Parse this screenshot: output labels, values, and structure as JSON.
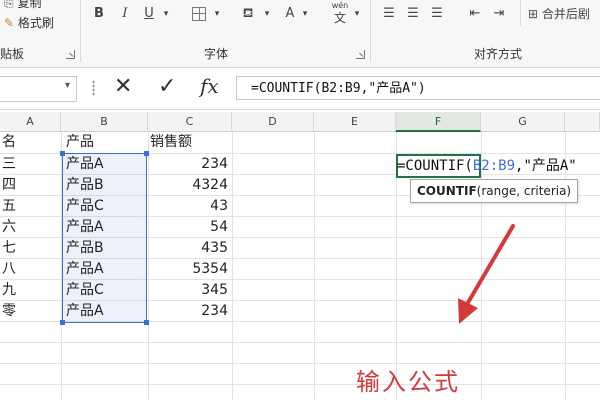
{
  "ribbon": {
    "clipboard_truncated": "复制",
    "format_painter": "格式刷",
    "clipboard_group": "贴板",
    "font_group": "字体",
    "alignment_group": "对齐方式",
    "bold": "B",
    "italic": "I",
    "underline": "U",
    "font_color": "A",
    "wen": "wén",
    "wen_char": "文",
    "merge_center": "合并后剧"
  },
  "formula_bar": {
    "cancel_symbol": "✕",
    "enter_symbol": "✓",
    "fx_label": "fx",
    "formula": "=COUNTIF(B2:B9,\"产品A\")"
  },
  "columns": [
    "A",
    "B",
    "C",
    "D",
    "E",
    "F",
    "G"
  ],
  "selected_column": "F",
  "header_row": {
    "a": "名",
    "b": "产品",
    "c": "销售额"
  },
  "rows": [
    {
      "a": "三",
      "b": "产品A",
      "c": "234"
    },
    {
      "a": "四",
      "b": "产品B",
      "c": "4324"
    },
    {
      "a": "五",
      "b": "产品C",
      "c": "43"
    },
    {
      "a": "六",
      "b": "产品A",
      "c": "54"
    },
    {
      "a": "七",
      "b": "产品B",
      "c": "435"
    },
    {
      "a": "八",
      "b": "产品A",
      "c": "5354"
    },
    {
      "a": "九",
      "b": "产品C",
      "c": "345"
    },
    {
      "a": "零",
      "b": "产品A",
      "c": "234"
    }
  ],
  "active_cell": {
    "prefix": "=COUNTIF(",
    "range_ref": "B2:B9",
    "suffix": ",\"产品A\""
  },
  "tooltip": {
    "func": "COUNTIF",
    "args": "(range, criteria)"
  },
  "annotation": "输入公式",
  "colors": {
    "accent": "#217346",
    "range_highlight": "#3b6fd6",
    "annotation": "#d13b3b"
  }
}
